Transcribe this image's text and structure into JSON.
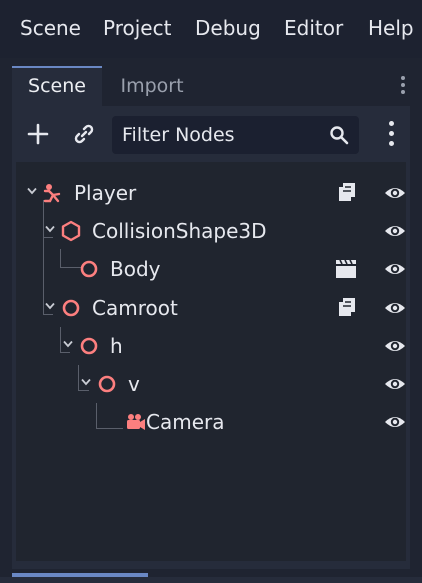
{
  "menu": [
    "Scene",
    "Project",
    "Debug",
    "Editor",
    "Help"
  ],
  "dock": {
    "tabs": [
      {
        "label": "Scene",
        "active": true
      },
      {
        "label": "Import",
        "active": false
      }
    ],
    "toolbar": {
      "add_icon": "plus-icon",
      "link_icon": "link-icon",
      "filter_placeholder": "Filter Nodes",
      "filter_value": ""
    }
  },
  "tree": [
    {
      "name": "Player",
      "icon": "character-node-icon"
    },
    {
      "name": "CollisionShape3D",
      "icon": "collision-shape-icon"
    },
    {
      "name": "Body",
      "icon": "node3d-icon"
    },
    {
      "name": "Camroot",
      "icon": "node3d-icon"
    },
    {
      "name": "h",
      "icon": "node3d-icon"
    },
    {
      "name": "v",
      "icon": "node3d-icon"
    },
    {
      "name": "Camera",
      "icon": "camera-icon"
    }
  ],
  "colors": {
    "node_icon": "#fc7f7f",
    "accent": "#6a88c4",
    "text": "#e6e8ee"
  }
}
